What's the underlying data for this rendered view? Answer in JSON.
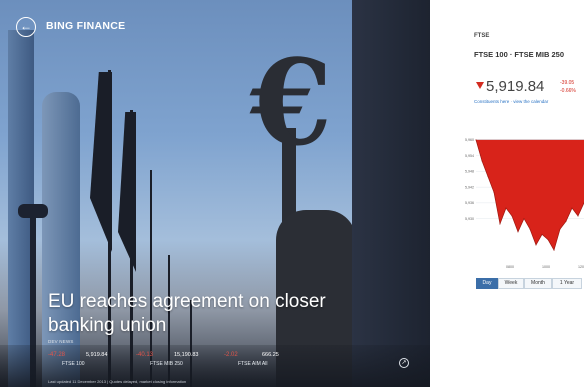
{
  "app": {
    "title": "BING FINANCE"
  },
  "hero": {
    "headline": "EU reaches agreement on closer banking union",
    "section_tag": "DEV NEWS",
    "tickers": [
      {
        "delta": "-47.28",
        "value": "5,919.84",
        "name": "FTSE 100"
      },
      {
        "delta": "-40.13",
        "value": "15,190.83",
        "name": "FTSE MIB 250"
      },
      {
        "delta": "-2.02",
        "value": "666.25",
        "name": "FTSE AIM All"
      }
    ],
    "caption": "Last updated 11 December 2013 | Quotes delayed, market closing information",
    "back_icon": "back-arrow-icon",
    "expand_icon": "expand-icon"
  },
  "market": {
    "logo": "FTSE",
    "indices": "FTSE 100 · FTSE MIB 250",
    "value": "5,919.84",
    "change": "-39.05",
    "change_pct": "-0.66%",
    "links": "Constituents here · view the calendar",
    "colors": {
      "down": "#d32b20",
      "area": "#d8231a",
      "accent": "#3b6ea8"
    },
    "range_tabs": [
      {
        "label": "Day",
        "active": true
      },
      {
        "label": "Week",
        "active": false
      },
      {
        "label": "Month",
        "active": false
      },
      {
        "label": "1 Year",
        "active": false
      }
    ]
  },
  "chart_data": {
    "type": "area",
    "x": [
      "0800",
      "1000",
      "1200",
      "1400",
      "1600"
    ],
    "values": [
      5960,
      5952,
      5946,
      5940,
      5928,
      5934,
      5931,
      5925,
      5930,
      5926,
      5920,
      5924,
      5922,
      5918,
      5926,
      5929,
      5934,
      5931,
      5936
    ],
    "y_ticks": [
      "5,960",
      "5,954",
      "5,948",
      "5,942",
      "5,936",
      "5,930"
    ],
    "x_ticks": [
      "0800",
      "1000",
      "1200"
    ],
    "ylim": [
      5915,
      5963
    ],
    "grid": true
  }
}
